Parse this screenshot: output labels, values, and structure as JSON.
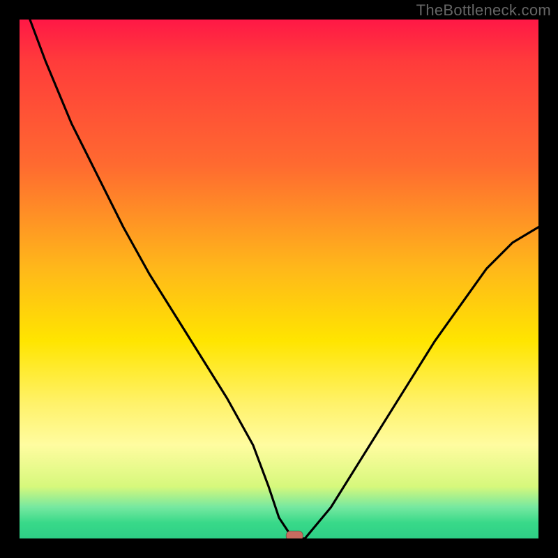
{
  "watermark": "TheBottleneck.com",
  "chart_data": {
    "type": "line",
    "title": "",
    "xlabel": "",
    "ylabel": "",
    "xlim": [
      0,
      100
    ],
    "ylim": [
      0,
      100
    ],
    "series": [
      {
        "name": "bottleneck-curve",
        "x": [
          2,
          5,
          10,
          15,
          20,
          25,
          30,
          35,
          40,
          45,
          48,
          50,
          52,
          54,
          55,
          60,
          65,
          70,
          75,
          80,
          85,
          90,
          95,
          100
        ],
        "y": [
          100,
          92,
          80,
          70,
          60,
          51,
          43,
          35,
          27,
          18,
          10,
          4,
          1,
          0,
          0,
          6,
          14,
          22,
          30,
          38,
          45,
          52,
          57,
          60
        ]
      }
    ],
    "optimum_marker": {
      "x": 53,
      "y": 0.5
    },
    "colors": {
      "gradient_top": "#ff1846",
      "gradient_mid": "#ffe500",
      "gradient_bottom": "#2ecf86",
      "curve": "#000000",
      "marker": "#c86b60",
      "frame": "#000000"
    }
  }
}
